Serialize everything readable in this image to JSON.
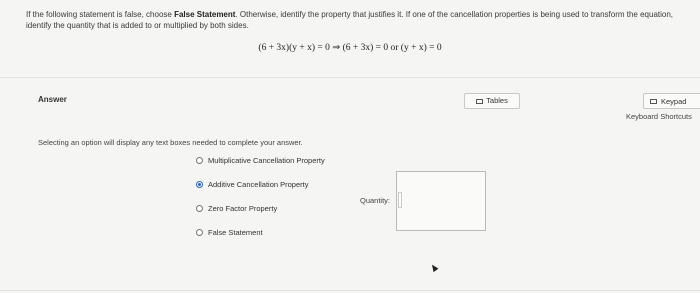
{
  "question": {
    "part1": "If the following statement is false, choose ",
    "bold": "False Statement",
    "part2": ". Otherwise, identify the property that justifies it. If one of the cancellation properties is being used to transform the equation, identify the quantity that is added to or multiplied by both sides.",
    "equation": "(6 + 3x)(y + x) = 0 ⇒ (6 + 3x) = 0 or (y + x) = 0"
  },
  "answer": {
    "label": "Answer",
    "instruction": "Selecting an option will display any text boxes needed to complete your answer.",
    "options": [
      {
        "label": "Multiplicative Cancellation Property",
        "selected": false
      },
      {
        "label": "Additive Cancellation Property",
        "selected": true
      },
      {
        "label": "Zero Factor Property",
        "selected": false
      },
      {
        "label": "False Statement",
        "selected": false
      }
    ],
    "quantity_label": "Quantity:"
  },
  "tools": {
    "tables_label": "Tables",
    "keypad_label": "Keypad",
    "shortcuts_label": "Keyboard Shortcuts"
  },
  "colors": {
    "accent": "#2c5fb3",
    "background": "#f5f5f3"
  }
}
